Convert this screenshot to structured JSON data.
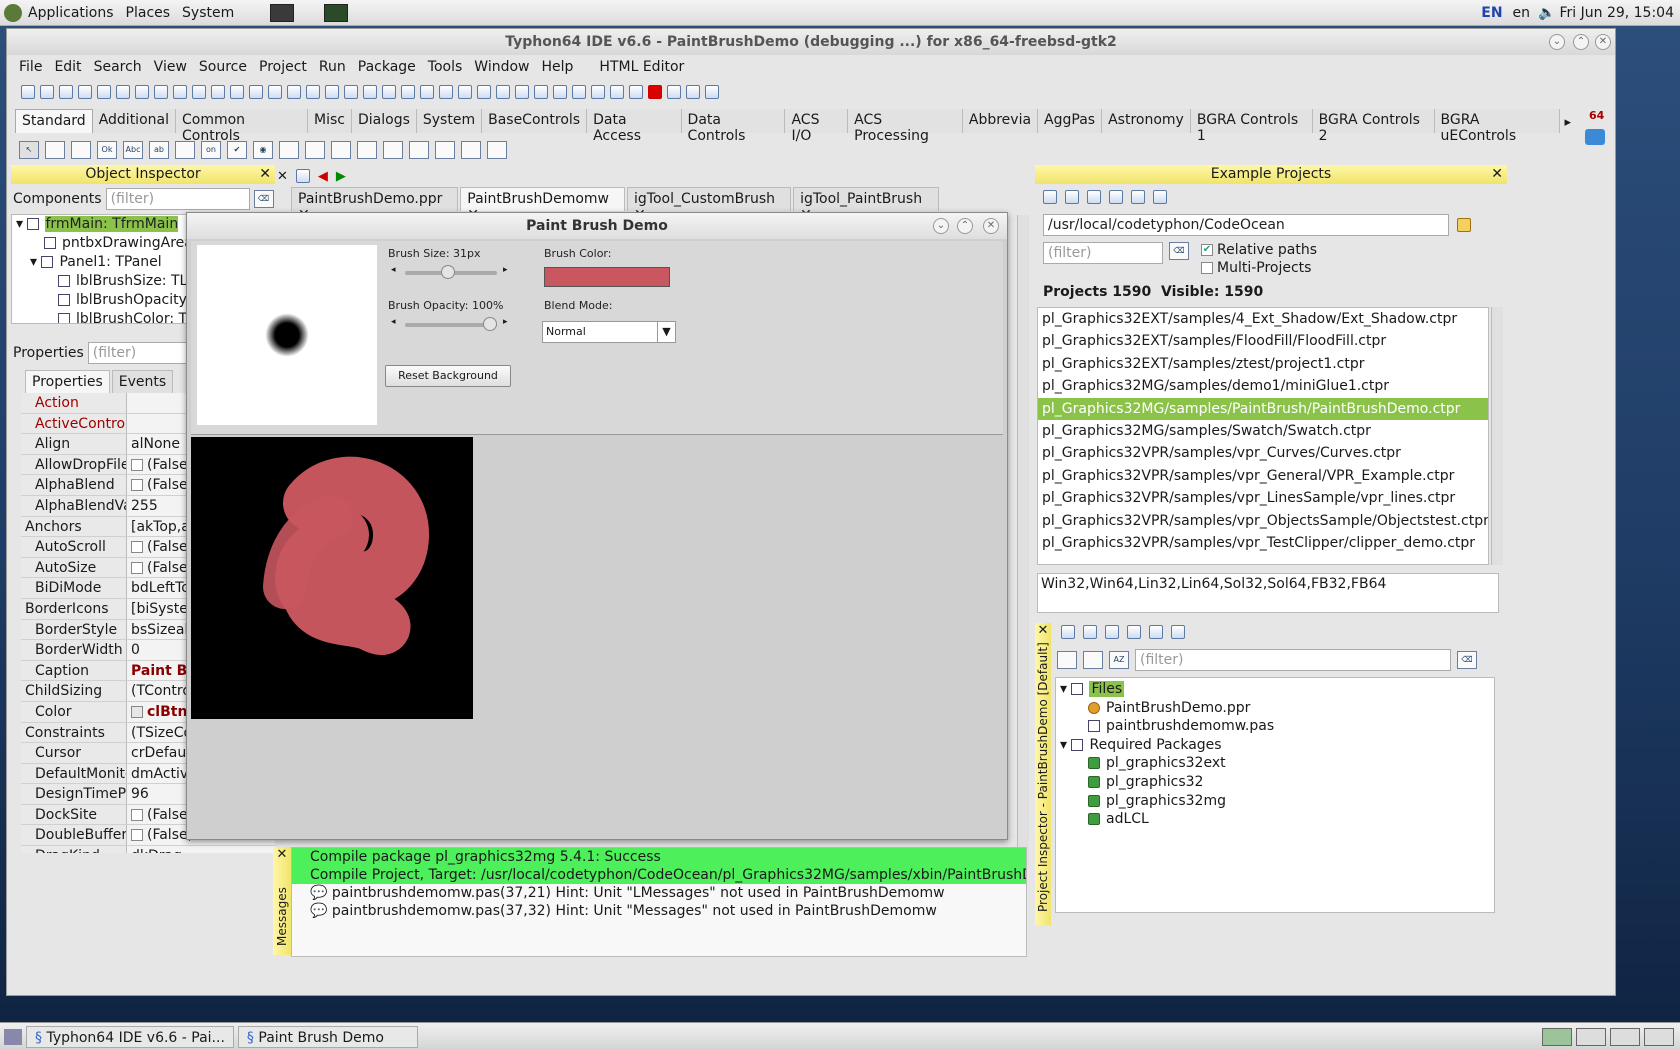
{
  "toppanel": {
    "menus": [
      "Applications",
      "Places",
      "System"
    ],
    "kbd": "EN",
    "lang": "en",
    "clock": "Fri Jun 29, 15:04"
  },
  "ide": {
    "title": "Typhon64 IDE v6.6 - PaintBrushDemo (debugging ...) for x86_64-freebsd-gtk2",
    "menu": [
      "File",
      "Edit",
      "Search",
      "View",
      "Source",
      "Project",
      "Run",
      "Package",
      "Tools",
      "Window",
      "Help",
      "HTML Editor"
    ],
    "palette_tabs": [
      "Standard",
      "Additional",
      "Common Controls",
      "Misc",
      "Dialogs",
      "System",
      "BaseControls",
      "Data Access",
      "Data Controls",
      "ACS I/O",
      "ACS Processing",
      "Abbrevia",
      "AggPas",
      "Astronomy",
      "BGRA Controls 1",
      "BGRA Controls 2",
      "BGRA uEControls"
    ],
    "arch_badge": "64"
  },
  "object_inspector": {
    "title": "Object Inspector",
    "components_label": "Components",
    "filter_placeholder": "(filter)",
    "tree": [
      "frmMain: TfrmMain",
      "pntbxDrawingArea: T",
      "Panel1: TPanel",
      "lblBrushSize: TLab",
      "lblBrushOpacity: T",
      "lblBrushColor: TLa"
    ],
    "properties_label": "Properties",
    "tabs": [
      "Properties",
      "Events"
    ],
    "props": [
      {
        "n": "Action",
        "v": ""
      },
      {
        "n": "ActiveControl",
        "v": ""
      },
      {
        "n": "Align",
        "v": "alNone"
      },
      {
        "n": "AllowDropFiles",
        "v": "(False)"
      },
      {
        "n": "AlphaBlend",
        "v": "(False)"
      },
      {
        "n": "AlphaBlendVal",
        "v": "255"
      },
      {
        "n": "Anchors",
        "v": "[akTop,akL"
      },
      {
        "n": "AutoScroll",
        "v": "(False)"
      },
      {
        "n": "AutoSize",
        "v": "(False)"
      },
      {
        "n": "BiDiMode",
        "v": "bdLeftToRig"
      },
      {
        "n": "BorderIcons",
        "v": "[biSystemM"
      },
      {
        "n": "BorderStyle",
        "v": "bsSizeable"
      },
      {
        "n": "BorderWidth",
        "v": "0"
      },
      {
        "n": "Caption",
        "v": "Paint Brus"
      },
      {
        "n": "ChildSizing",
        "v": "(TControlCh"
      },
      {
        "n": "Color",
        "v": "clBtnFa"
      },
      {
        "n": "Constraints",
        "v": "(TSizeCons"
      },
      {
        "n": "Cursor",
        "v": "crDefault"
      },
      {
        "n": "DefaultMonito",
        "v": "dmActiveFo"
      },
      {
        "n": "DesignTimePP",
        "v": "96"
      },
      {
        "n": "DockSite",
        "v": "(False)"
      },
      {
        "n": "DoubleBuffere",
        "v": "(False)"
      },
      {
        "n": "DragKind",
        "v": "dkDrag"
      }
    ]
  },
  "editor_tabs": [
    "PaintBrushDemo.ppr",
    "PaintBrushDemomw",
    "igTool_CustomBrush",
    "igTool_PaintBrush"
  ],
  "paint_demo": {
    "title": "Paint Brush Demo",
    "brush_size_label": "Brush Size: 31px",
    "brush_size": 31,
    "brush_opacity_label": "Brush Opacity: 100%",
    "brush_opacity": 1.0,
    "brush_color_label": "Brush Color:",
    "brush_color": "#c8575f",
    "blend_label": "Blend Mode:",
    "blend_value": "Normal",
    "reset_label": "Reset Background"
  },
  "messages": {
    "side_label": "Messages",
    "rows": [
      {
        "t": "Compile package pl_graphics32mg 5.4.1: Success",
        "ok": true
      },
      {
        "t": "Compile Project, Target: /usr/local/codetyphon/CodeOcean/pl_Graphics32MG/samples/xbin/PaintBrushDemo: Success, Hi",
        "ok": true
      },
      {
        "t": "paintbrushdemomw.pas(37,21) Hint: Unit \"LMessages\" not used in PaintBrushDemomw",
        "ok": false
      },
      {
        "t": "paintbrushdemomw.pas(37,32) Hint: Unit \"Messages\" not used in PaintBrushDemomw",
        "ok": false
      }
    ]
  },
  "example_projects": {
    "title": "Example Projects",
    "path": "/usr/local/codetyphon/CodeOcean",
    "filter_placeholder": "(filter)",
    "relative_paths": "Relative paths",
    "multi_projects": "Multi-Projects",
    "counts": "Projects 1590  Visible: 1590",
    "items": [
      "pl_Graphics32EXT/samples/4_Ext_Shadow/Ext_Shadow.ctpr",
      "pl_Graphics32EXT/samples/FloodFill/FloodFill.ctpr",
      "pl_Graphics32EXT/samples/ztest/project1.ctpr",
      "pl_Graphics32MG/samples/demo1/miniGlue1.ctpr",
      "pl_Graphics32MG/samples/PaintBrush/PaintBrushDemo.ctpr",
      "pl_Graphics32MG/samples/Swatch/Swatch.ctpr",
      "pl_Graphics32VPR/samples/vpr_Curves/Curves.ctpr",
      "pl_Graphics32VPR/samples/vpr_General/VPR_Example.ctpr",
      "pl_Graphics32VPR/samples/vpr_LinesSample/vpr_lines.ctpr",
      "pl_Graphics32VPR/samples/vpr_ObjectsSample/Objectstest.ctpr",
      "pl_Graphics32VPR/samples/vpr_TestClipper/clipper_demo.ctpr"
    ],
    "selected": 4,
    "platforms": "Win32,Win64,Lin32,Lin64,Sol32,Sol64,FB32,FB64"
  },
  "project_inspector": {
    "side_label": "Project Inspector - PaintBrushDemo [Default]",
    "filter_placeholder": "(filter)",
    "files_label": "Files",
    "files": [
      "PaintBrushDemo.ppr",
      "paintbrushdemomw.pas"
    ],
    "req_label": "Required Packages",
    "packages": [
      "pl_graphics32ext",
      "pl_graphics32",
      "pl_graphics32mg",
      "adLCL"
    ]
  },
  "taskbar": {
    "tasks": [
      "Typhon64 IDE v6.6 - Pai...",
      "Paint Brush Demo"
    ]
  }
}
